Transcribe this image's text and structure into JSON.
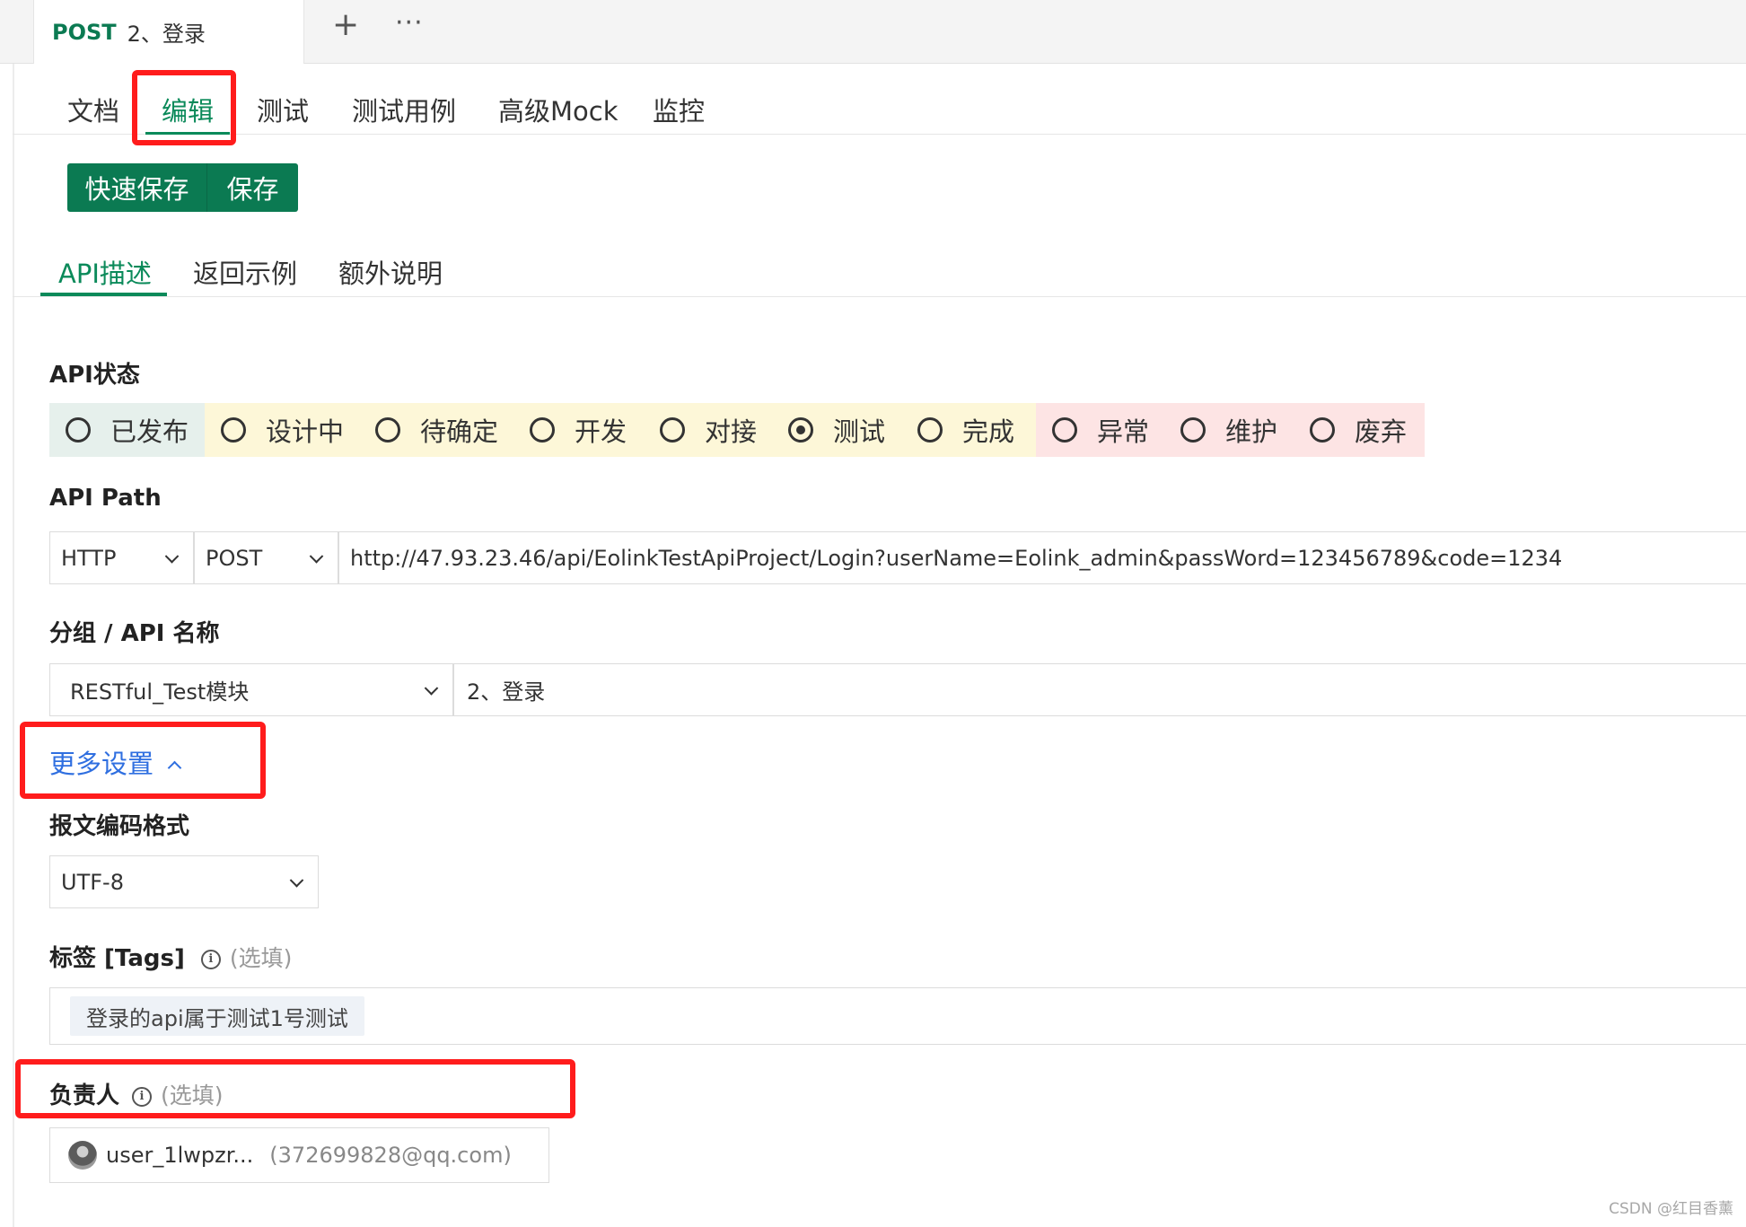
{
  "request_tab": {
    "method": "POST",
    "name": "2、登录",
    "add_icon": "+",
    "more_icon": "···"
  },
  "main_nav": [
    {
      "label": "文档"
    },
    {
      "label": "编辑",
      "active": true
    },
    {
      "label": "测试"
    },
    {
      "label": "测试用例"
    },
    {
      "label": "高级Mock"
    },
    {
      "label": "监控"
    }
  ],
  "buttons": {
    "quick_save": "快速保存",
    "save": "保存"
  },
  "sub_nav": [
    {
      "label": "API描述",
      "active": true
    },
    {
      "label": "返回示例"
    },
    {
      "label": "额外说明"
    }
  ],
  "api_status": {
    "label": "API状态",
    "selected": "测试",
    "options": [
      {
        "label": "已发布",
        "group": "green"
      },
      {
        "label": "设计中",
        "group": "yellow"
      },
      {
        "label": "待确定",
        "group": "yellow"
      },
      {
        "label": "开发",
        "group": "yellow"
      },
      {
        "label": "对接",
        "group": "yellow"
      },
      {
        "label": "测试",
        "group": "yellow"
      },
      {
        "label": "完成",
        "group": "yellow"
      },
      {
        "label": "异常",
        "group": "red"
      },
      {
        "label": "维护",
        "group": "red"
      },
      {
        "label": "废弃",
        "group": "red"
      }
    ],
    "colors": {
      "green": "#e6f0ec",
      "yellow": "#fdf7d8",
      "red": "#fde4e4"
    }
  },
  "api_path": {
    "label": "API Path",
    "protocol": "HTTP",
    "method": "POST",
    "url": "http://47.93.23.46/api/EolinkTestApiProject/Login?userName=Eolink_admin&passWord=123456789&code=1234"
  },
  "group_name": {
    "label": "分组 / API 名称",
    "group": "RESTful_Test模块",
    "name": "2、登录"
  },
  "more_settings": {
    "label": "更多设置"
  },
  "encoding": {
    "label": "报文编码格式",
    "value": "UTF-8"
  },
  "tags": {
    "label": "标签 [Tags]",
    "optional": "(选填)",
    "items": [
      "登录的api属于测试1号测试"
    ]
  },
  "owner": {
    "label": "负责人",
    "optional": "(选填)",
    "name": "user_1lwpzr...",
    "email": "(372699828@qq.com)"
  },
  "watermark": "CSDN @红目香薰",
  "theme": {
    "accent": "#0b7a52",
    "link": "#2f6fe0",
    "annotation": "#ff1c1c"
  }
}
